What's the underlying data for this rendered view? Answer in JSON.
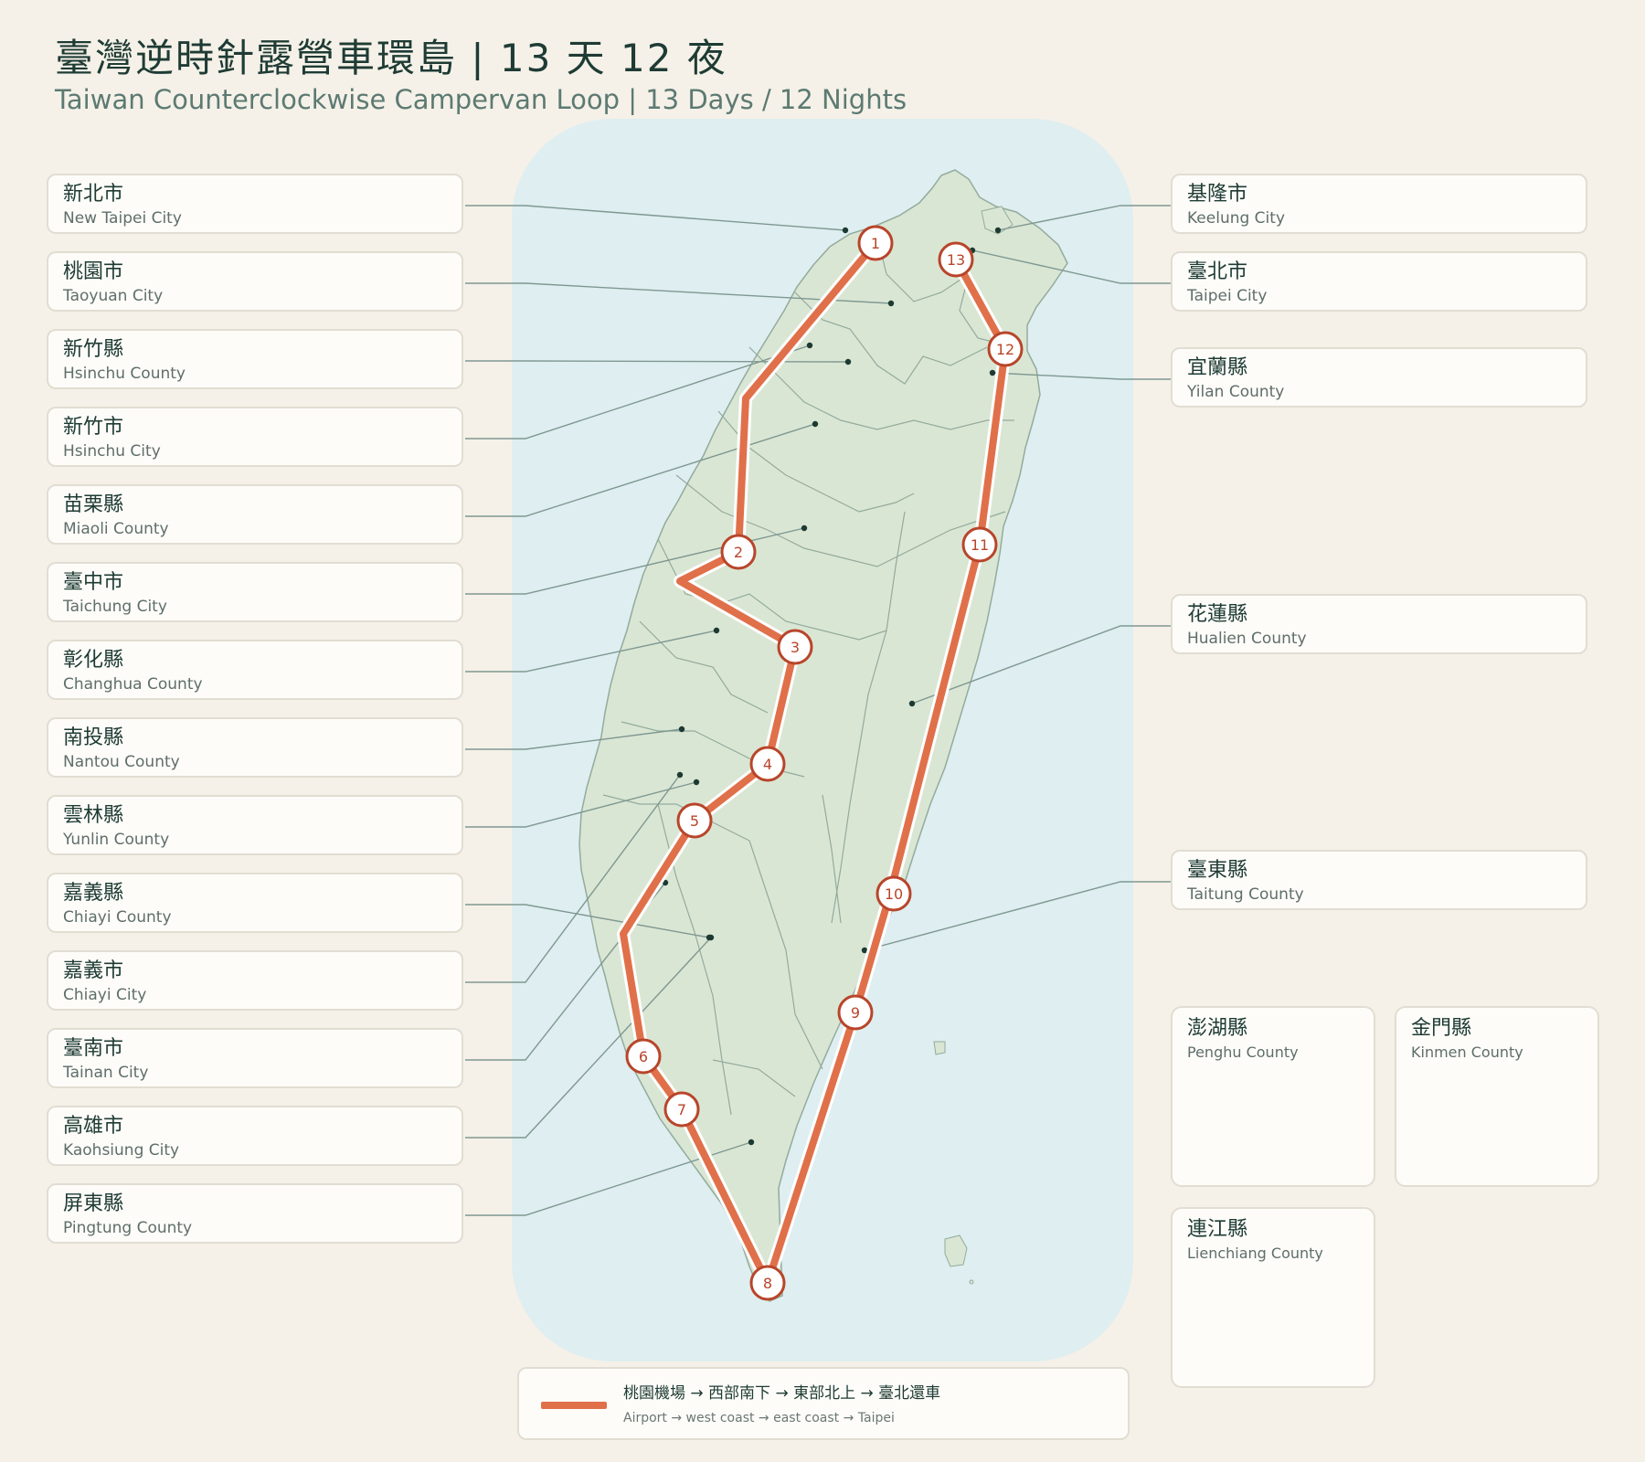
{
  "title": {
    "zh": "臺灣逆時針露營車環島 | 13 天 12 夜",
    "en": "Taiwan Counterclockwise Campervan Loop | 13 Days / 12 Nights"
  },
  "colors": {
    "background": "#f5f1e8",
    "sea": "#dfeef0",
    "land": "#dae6d4",
    "boundary": "#93ab9d",
    "route": "#e0704a",
    "route_outline": "#ffffff",
    "marker_fill": "#ffffff",
    "marker_stroke": "#b8452a",
    "leader": "#7e9891",
    "dot": "#1c3a32"
  },
  "left_counties": [
    {
      "zh": "新北市",
      "en": "New Taipei City"
    },
    {
      "zh": "桃園市",
      "en": "Taoyuan City"
    },
    {
      "zh": "新竹縣",
      "en": "Hsinchu County"
    },
    {
      "zh": "新竹市",
      "en": "Hsinchu City"
    },
    {
      "zh": "苗栗縣",
      "en": "Miaoli County"
    },
    {
      "zh": "臺中市",
      "en": "Taichung City"
    },
    {
      "zh": "彰化縣",
      "en": "Changhua County"
    },
    {
      "zh": "南投縣",
      "en": "Nantou County"
    },
    {
      "zh": "雲林縣",
      "en": "Yunlin County"
    },
    {
      "zh": "嘉義縣",
      "en": "Chiayi County"
    },
    {
      "zh": "嘉義市",
      "en": "Chiayi City"
    },
    {
      "zh": "臺南市",
      "en": "Tainan City"
    },
    {
      "zh": "高雄市",
      "en": "Kaohsiung City"
    },
    {
      "zh": "屏東縣",
      "en": "Pingtung County"
    }
  ],
  "right_counties": [
    {
      "zh": "基隆市",
      "en": "Keelung City"
    },
    {
      "zh": "臺北市",
      "en": "Taipei City"
    },
    {
      "zh": "宜蘭縣",
      "en": "Yilan County"
    },
    {
      "zh": "花蓮縣",
      "en": "Hualien County"
    },
    {
      "zh": "臺東縣",
      "en": "Taitung County"
    }
  ],
  "insets": {
    "penghu": {
      "zh": "澎湖縣",
      "en": "Penghu County"
    },
    "kinmen": {
      "zh": "金門縣",
      "en": "Kinmen County"
    },
    "lienchiang": {
      "zh": "連江縣",
      "en": "Lienchiang County"
    }
  },
  "route_stops": [
    "1",
    "2",
    "3",
    "4",
    "5",
    "6",
    "7",
    "8",
    "9",
    "10",
    "11",
    "12",
    "13"
  ],
  "legend": {
    "zh": "桃園機場 → 西部南下 → 東部北上 → 臺北還車",
    "en": "Airport → west coast → east coast → Taipei"
  }
}
